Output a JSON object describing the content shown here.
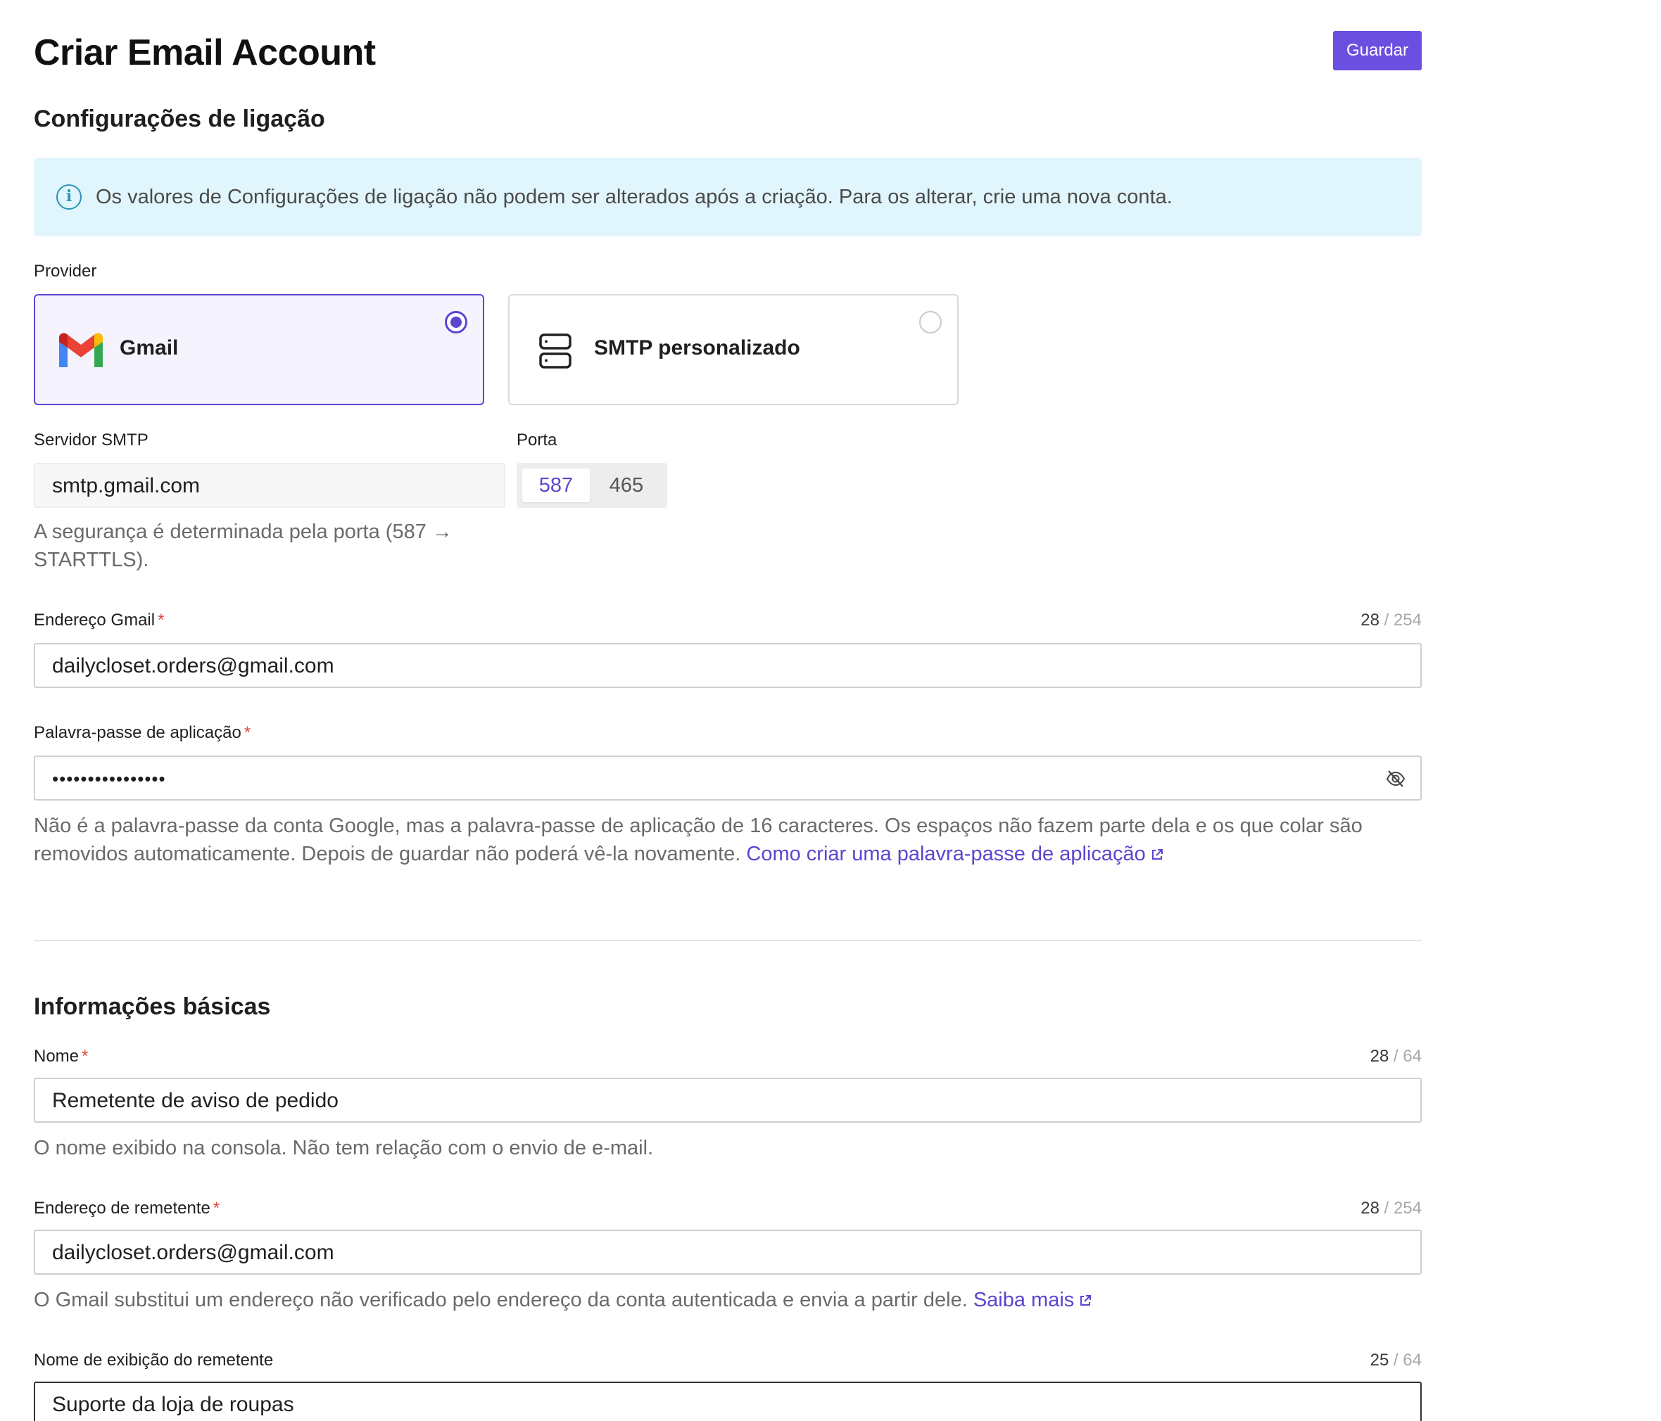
{
  "header": {
    "title": "Criar Email Account",
    "save_label": "Guardar"
  },
  "connection": {
    "section_title": "Configurações de ligação",
    "info_text": "Os valores de Configurações de ligação não podem ser alterados após a criação. Para os alterar, crie uma nova conta.",
    "provider_label": "Provider",
    "providers": [
      {
        "name": "Gmail",
        "icon": "gmail-icon",
        "selected": true
      },
      {
        "name": "SMTP personalizado",
        "icon": "server-icon",
        "selected": false
      }
    ],
    "smtp_server_label": "Servidor SMTP",
    "smtp_server_value": "smtp.gmail.com",
    "port_label": "Porta",
    "port_options": [
      "587",
      "465"
    ],
    "port_selected": "587",
    "security_help_line1": "A segurança é determinada pela porta (587 →",
    "security_help_line2": "STARTTLS).",
    "gmail_address_label": "Endereço Gmail",
    "gmail_address_value": "dailycloset.orders@gmail.com",
    "gmail_address_count": "28",
    "gmail_address_max": "/ 254",
    "app_password_label": "Palavra-passe de aplicação",
    "app_password_value": "••••••••••••••••",
    "app_password_help_line1": "Não é a palavra-passe da conta Google, mas a palavra-passe de aplicação de 16 caracteres. Os espaços não fazem parte dela e os que colar são",
    "app_password_help_line2": "removidos automaticamente. Depois de guardar não poderá vê-la novamente.",
    "app_password_link": "Como criar uma palavra-passe de aplicação"
  },
  "basic": {
    "section_title": "Informações básicas",
    "name_label": "Nome",
    "name_value": "Remetente de aviso de pedido",
    "name_count": "28",
    "name_max": "/ 64",
    "name_help": "O nome exibido na consola. Não tem relação com o envio de e-mail.",
    "sender_address_label": "Endereço de remetente",
    "sender_address_value": "dailycloset.orders@gmail.com",
    "sender_address_count": "28",
    "sender_address_max": "/ 254",
    "sender_address_help": "O Gmail substitui um endereço não verificado pelo endereço da conta autenticada e envia a partir dele.",
    "sender_address_link": "Saiba mais",
    "sender_display_label": "Nome de exibição do remetente",
    "sender_display_value": "Suporte da loja de roupas",
    "sender_display_count": "25",
    "sender_display_max": "/ 64"
  },
  "colors": {
    "accent": "#5b46d0",
    "button": "#6a4fe0",
    "info_bg": "#e1f6fc",
    "required": "#e0463c"
  }
}
